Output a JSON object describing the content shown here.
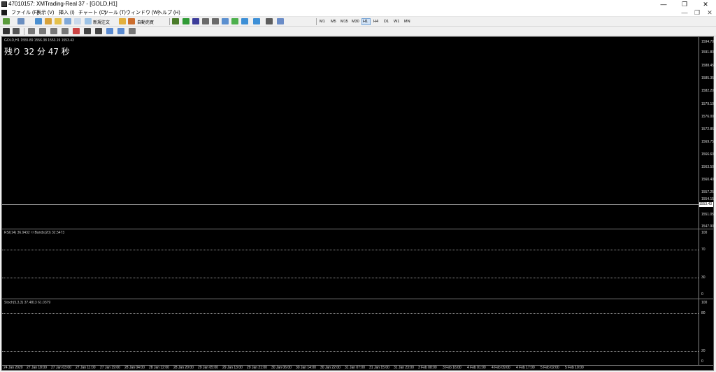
{
  "window": {
    "title": "47010157: XMTrading-Real 37 - [GOLD,H1]",
    "minimize": "—",
    "maximize": "❐",
    "close": "✕"
  },
  "menu": [
    "ファイル (F)",
    "表示 (V)",
    "挿入 (I)",
    "チャート (C)",
    "ツール (T)",
    "ウィンドウ (W)",
    "ヘルプ (H)"
  ],
  "toolbar": {
    "new_order": "新規注文",
    "auto_trade": "自動売買"
  },
  "periods": [
    "M1",
    "M5",
    "M15",
    "M30",
    "H1",
    "H4",
    "D1",
    "W1",
    "MN"
  ],
  "selected_period": "H1",
  "chart": {
    "symbol_line": "GOLD,H1  1555.89 1556.38 1553.19 1553.43",
    "timer": "残り 32 分 47 秒",
    "current_price": "1553.43",
    "price_ticks": [
      "1594.70",
      "1591.80",
      "1588.45",
      "1585.35",
      "1582.20",
      "1579.10",
      "1576.00",
      "1572.85",
      "1569.75",
      "1566.60",
      "1563.50",
      "1560.40",
      "1557.25",
      "1554.15",
      "1551.05",
      "1547.90"
    ],
    "rsi_label": "RSI(14) 36.9432  ≈≈Bands(20) 32.5473",
    "rsi_ticks": [
      "100",
      "70",
      "30",
      "0"
    ],
    "stoch_label": "Stoch(5,3,3) 37.4813 61.0379",
    "stoch_ticks": [
      "100",
      "80",
      "20",
      "0"
    ],
    "time_ticks": [
      "24 Jan 2020",
      "27 Jan 18:00",
      "27 Jan 03:00",
      "27 Jan 11:00",
      "27 Jan 19:00",
      "28 Jan 04:00",
      "28 Jan 12:00",
      "28 Jan 20:00",
      "29 Jan 05:00",
      "29 Jan 13:00",
      "29 Jan 21:00",
      "30 Jan 06:00",
      "30 Jan 14:00",
      "30 Jan 22:00",
      "31 Jan 07:00",
      "31 Jan 15:00",
      "31 Jan 23:00",
      "3 Feb 08:00",
      "3 Feb 16:00",
      "4 Feb 01:00",
      "4 Feb 09:00",
      "4 Feb 17:00",
      "5 Feb 02:00",
      "5 Feb 10:00"
    ]
  }
}
